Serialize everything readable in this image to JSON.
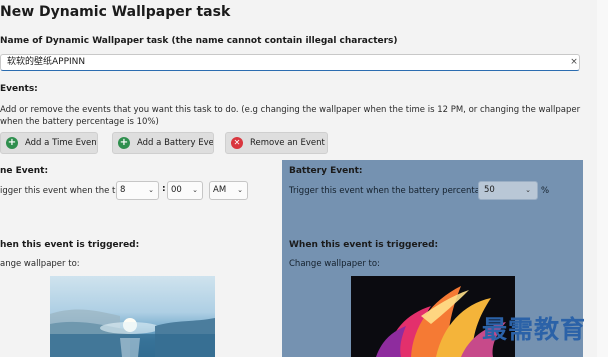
{
  "header": {
    "title": "New Dynamic Wallpaper task"
  },
  "task_name": {
    "label": "Name of Dynamic Wallpaper task (the name cannot contain illegal characters)",
    "value": "软软的壁纸APPINN",
    "clear_icon": "×"
  },
  "events": {
    "label": "Events:",
    "description": "Add or remove the events that you want this task to do. (e.g changing the wallpaper when the time is 12 PM, or changing the wallpaper when the battery percentage is 10%)",
    "buttons": {
      "add_time": "Add a Time Event",
      "add_battery": "Add a Battery Event",
      "remove": "Remove an Event"
    }
  },
  "time_event": {
    "title": "ne Event:",
    "trigger_text": "igger this event when the time is",
    "hour": "8",
    "minute": "00",
    "ampm": "AM",
    "colon": ":",
    "triggered_title": "hen this event is triggered:",
    "change_text": "ange wallpaper to:"
  },
  "battery_event": {
    "title": "Battery Event:",
    "trigger_text": "Trigger this event when the battery percentage is",
    "percentage": "50",
    "unit": "%",
    "triggered_title": "When this event is triggered:",
    "change_text": "Change wallpaper to:"
  },
  "watermark": "最需教育",
  "icons": {
    "plus": "+",
    "remove": "✕",
    "chevron": "⌄"
  }
}
